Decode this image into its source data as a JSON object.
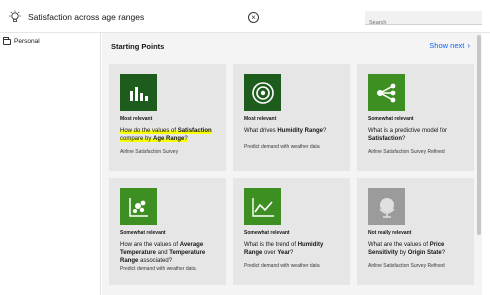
{
  "header": {
    "query": "Satisfaction across age ranges",
    "search_placeholder": "Search"
  },
  "sidebar": {
    "items": [
      {
        "label": "Personal"
      }
    ]
  },
  "main": {
    "title": "Starting Points",
    "show_next": "Show next"
  },
  "colors": {
    "tile_dark": "#1e5c1e",
    "tile_green": "#3d8f22",
    "tile_gray": "#9b9b9b",
    "link": "#0f62fe",
    "highlight": "#f7ff00"
  },
  "cards": [
    {
      "relevance": "Most relevant",
      "q": [
        "How do the values of ",
        "Satisfaction",
        " compare by ",
        "Age Range",
        "?"
      ],
      "source": "Airline Satisfaction Survey",
      "icon": "bar-chart-icon",
      "highlighted": true
    },
    {
      "relevance": "Most relevant",
      "q": [
        "What drives ",
        "Humidity Range",
        "?"
      ],
      "source": "Predict demand with weather data",
      "icon": "target-icon"
    },
    {
      "relevance": "Somewhat relevant",
      "q": [
        "What is a predictive model for ",
        "Satisfaction",
        "?"
      ],
      "source": "Airline Satisfaction Survey Refined",
      "icon": "network-icon"
    },
    {
      "relevance": "Somewhat relevant",
      "q": [
        "How are the values of ",
        "Average Temperature",
        " and ",
        "Temperature Range",
        " associated?"
      ],
      "source": "Predict demand with weather data",
      "icon": "scatter-icon"
    },
    {
      "relevance": "Somewhat relevant",
      "q": [
        "What is the trend of ",
        "Humidity Range",
        " over ",
        "Year",
        "?"
      ],
      "source": "Predict demand with weather data",
      "icon": "line-chart-icon"
    },
    {
      "relevance": "Not really relevant",
      "q": [
        "What are the values of ",
        "Price Sensitivity",
        " by ",
        "Origin State",
        "?"
      ],
      "source": "Airline Satisfaction Survey Refined",
      "icon": "globe-icon"
    }
  ]
}
